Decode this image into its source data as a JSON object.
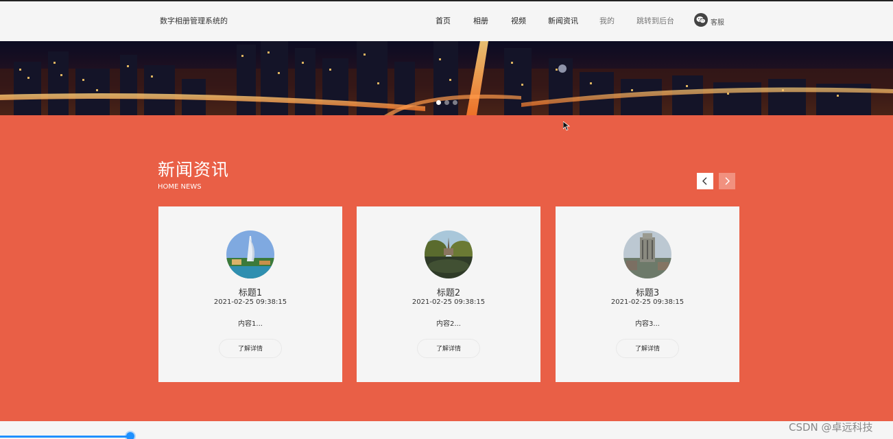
{
  "header": {
    "brand": "数字相册管理系统的",
    "nav": [
      {
        "label": "首页"
      },
      {
        "label": "相册"
      },
      {
        "label": "视频"
      },
      {
        "label": "新闻资讯"
      },
      {
        "label": "我的"
      },
      {
        "label": "跳转到后台"
      }
    ],
    "service_label": "客服",
    "service_icon": "wechat-icon"
  },
  "banner": {
    "slides": 3,
    "active_slide": 1
  },
  "news": {
    "title": "新闻资讯",
    "subtitle": "HOME NEWS",
    "prev_icon": "chevron-left-icon",
    "next_icon": "chevron-right-icon",
    "cards": [
      {
        "title": "标题1",
        "date": "2021-02-25 09:38:15",
        "body": "内容1...",
        "button": "了解详情"
      },
      {
        "title": "标题2",
        "date": "2021-02-25 09:38:15",
        "body": "内容2...",
        "button": "了解详情"
      },
      {
        "title": "标题3",
        "date": "2021-02-25 09:38:15",
        "body": "内容3...",
        "button": "了解详情"
      }
    ]
  },
  "watermark": "CSDN @卓远科技",
  "colors": {
    "accent": "#e95f46",
    "background": "#f5f5f5",
    "scrollbar": "#1e90ff"
  }
}
